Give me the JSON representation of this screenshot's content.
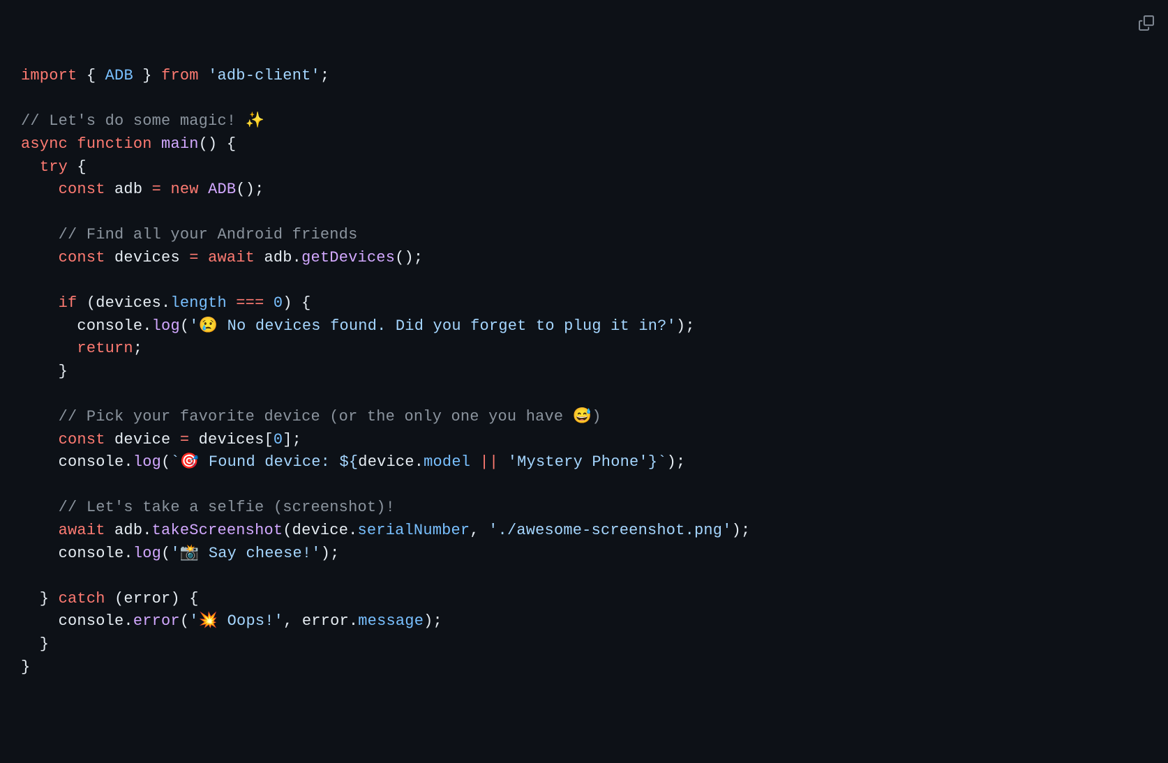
{
  "code": {
    "line01": {
      "import": "import",
      "space1": " { ",
      "adb": "ADB",
      "space2": " } ",
      "from": "from",
      "space3": " ",
      "str": "'adb-client'",
      "semi": ";"
    },
    "line02": "",
    "line03": "// Let's do some magic! ✨",
    "line04": {
      "async": "async",
      "sp1": " ",
      "function": "function",
      "sp2": " ",
      "main": "main",
      "rest": "() {"
    },
    "line05": {
      "indent": "  ",
      "try": "try",
      "rest": " {"
    },
    "line06": {
      "indent": "    ",
      "const": "const",
      "sp1": " adb ",
      "eq": "=",
      "sp2": " ",
      "new": "new",
      "sp3": " ",
      "cls": "ADB",
      "rest": "();"
    },
    "line07": "",
    "line08": {
      "indent": "    ",
      "cmt": "// Find all your Android friends"
    },
    "line09": {
      "indent": "    ",
      "const": "const",
      "sp1": " devices ",
      "eq": "=",
      "sp2": " ",
      "await": "await",
      "sp3": " adb.",
      "fn": "getDevices",
      "rest": "();"
    },
    "line10": "",
    "line11": {
      "indent": "    ",
      "if": "if",
      "sp1": " (devices.",
      "len": "length",
      "sp2": " ",
      "op": "===",
      "sp3": " ",
      "num": "0",
      "rest": ") {"
    },
    "line12": {
      "indent": "      console.",
      "fn": "log",
      "open": "(",
      "str": "'😢 No devices found. Did you forget to plug it in?'",
      "rest": ");"
    },
    "line13": {
      "indent": "      ",
      "return": "return",
      "rest": ";"
    },
    "line14": "    }",
    "line15": "",
    "line16": {
      "indent": "    ",
      "cmt": "// Pick your favorite device (or the only one you have 😅)"
    },
    "line17": {
      "indent": "    ",
      "const": "const",
      "sp1": " device ",
      "eq": "=",
      "sp2": " devices[",
      "num": "0",
      "rest": "];"
    },
    "line18": {
      "indent": "    console.",
      "fn": "log",
      "open": "(",
      "tick1": "`🎯 Found device: ",
      "dollar": "${",
      "expr1": "device",
      "dot": ".",
      "prop": "model",
      "sp": " ",
      "or": "||",
      "sp2": " ",
      "fallback": "'Mystery Phone'",
      "close_interp": "}",
      "tick2": "`",
      "rest": ");"
    },
    "line19": "",
    "line20": {
      "indent": "    ",
      "cmt": "// Let's take a selfie (screenshot)!"
    },
    "line21": {
      "indent": "    ",
      "await": "await",
      "sp1": " adb.",
      "fn": "takeScreenshot",
      "open": "(device.",
      "prop": "serialNumber",
      "comma": ", ",
      "str": "'./awesome-screenshot.png'",
      "rest": ");"
    },
    "line22": {
      "indent": "    console.",
      "fn": "log",
      "open": "(",
      "str": "'📸 Say cheese!'",
      "rest": ");"
    },
    "line23": "",
    "line24": {
      "indent": "  } ",
      "catch": "catch",
      "rest": " (error) {"
    },
    "line25": {
      "indent": "    console.",
      "fn": "error",
      "open": "(",
      "str": "'💥 Oops!'",
      "comma": ", error.",
      "prop": "message",
      "rest": ");"
    },
    "line26": "  }",
    "line27": "}"
  }
}
